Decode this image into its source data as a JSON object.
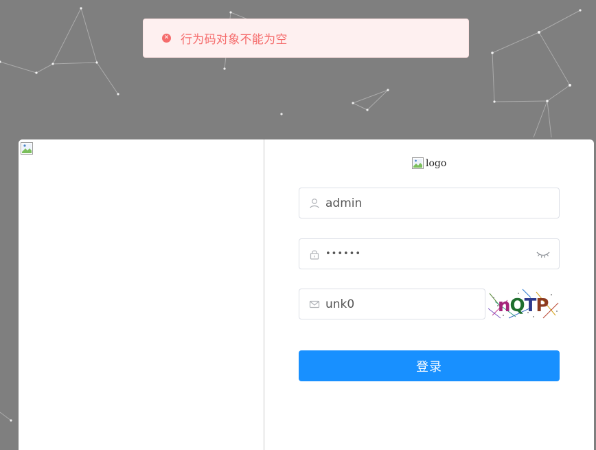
{
  "toast": {
    "message": "行为码对象不能为空",
    "icon": "error-circle-icon",
    "color": "#f56c6c"
  },
  "logo": {
    "alt_text": "logo"
  },
  "form": {
    "username": {
      "value": "admin",
      "icon": "user-icon"
    },
    "password": {
      "value": "••••••",
      "icon": "lock-icon",
      "toggle_icon": "eye-closed-icon"
    },
    "captcha": {
      "value": "unk0",
      "icon": "mail-icon",
      "image_text": "nQTP"
    },
    "submit_label": "登录"
  },
  "colors": {
    "background": "#7f7f7f",
    "primary": "#1890ff",
    "error": "#f56c6c"
  }
}
